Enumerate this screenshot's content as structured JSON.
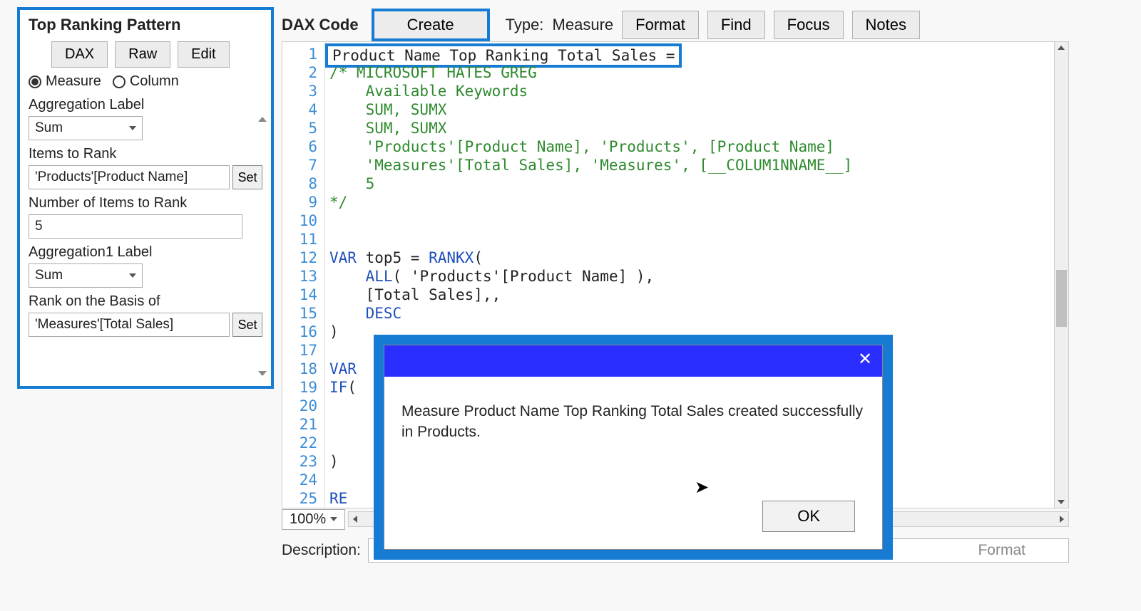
{
  "sidebar": {
    "title": "Top Ranking Pattern",
    "buttons": {
      "dax": "DAX",
      "raw": "Raw",
      "edit": "Edit"
    },
    "radio": {
      "measure": "Measure",
      "column": "Column",
      "selected": "measure"
    },
    "agg_label_label": "Aggregation Label",
    "agg_label_value": "Sum",
    "items_label": "Items to Rank",
    "items_value": "'Products'[Product Name]",
    "num_label": "Number of Items to Rank",
    "num_value": "5",
    "agg1_label_label": "Aggregation1 Label",
    "agg1_label_value": "Sum",
    "basis_label": "Rank on the Basis of",
    "basis_value": "'Measures'[Total Sales]",
    "set": "Set"
  },
  "header": {
    "title": "DAX Code",
    "create": "Create",
    "type_label": "Type:",
    "type_value": "Measure",
    "format": "Format",
    "find": "Find",
    "focus": "Focus",
    "notes": "Notes"
  },
  "code": {
    "lines": [
      "Product Name Top Ranking Total Sales =",
      "/* MICROSOFT HATES GREG",
      "    Available Keywords",
      "    SUM, SUMX",
      "    SUM, SUMX",
      "    'Products'[Product Name], 'Products', [Product Name]",
      "    'Measures'[Total Sales], 'Measures', [__COLUM1NNAME__]",
      "    5",
      "*/",
      "",
      "",
      "VAR top5 = RANKX(",
      "    ALL( 'Products'[Product Name] ),",
      "    [Total Sales],,",
      "    DESC",
      ")",
      "",
      "VAR",
      "IF(",
      "",
      "",
      "",
      ")",
      "",
      "RE"
    ],
    "first_line_no": 1
  },
  "zoom": "100%",
  "description_label": "Description:",
  "description_right": "Format",
  "dialog": {
    "message": "Measure Product Name Top Ranking Total Sales created successfully in Products.",
    "ok": "OK"
  }
}
